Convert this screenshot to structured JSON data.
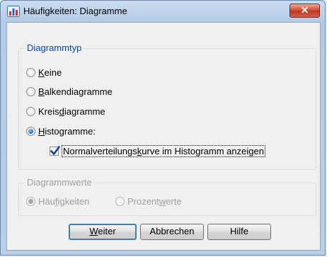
{
  "window": {
    "title": "Häufigkeiten: Diagramme",
    "icon": "spss-chart-icon",
    "close_symbol": "✕",
    "accent_colors": {
      "group_legend": "#0046d5",
      "disabled_text": "#a0a0a0",
      "close_button": "#c8412c"
    }
  },
  "chart_type_group": {
    "legend": "Diagrammtyp",
    "options": [
      {
        "before": "",
        "mnemonic": "K",
        "after": "eine",
        "selected": false
      },
      {
        "before": "",
        "mnemonic": "B",
        "after": "alkendiagramme",
        "selected": false
      },
      {
        "before": "Kreis",
        "mnemonic": "d",
        "after": "iagramme",
        "selected": false
      },
      {
        "before": "",
        "mnemonic": "H",
        "after": "istogramme:",
        "selected": true
      }
    ],
    "normal_curve": {
      "before": "Normalverteilungs",
      "mnemonic": "k",
      "after": "urve im Histogramm anzeigen",
      "checked": true
    }
  },
  "chart_values_group": {
    "legend": "Diagrammwerte",
    "enabled": false,
    "options": [
      {
        "before": "Häu",
        "mnemonic": "f",
        "after": "igkeiten",
        "selected": true
      },
      {
        "before": "Prozent",
        "mnemonic": "w",
        "after": "erte",
        "selected": false
      }
    ]
  },
  "buttons": {
    "continue": {
      "mnemonic": "W",
      "after": "eiter"
    },
    "cancel": "Abbrechen",
    "help": "Hilfe"
  }
}
